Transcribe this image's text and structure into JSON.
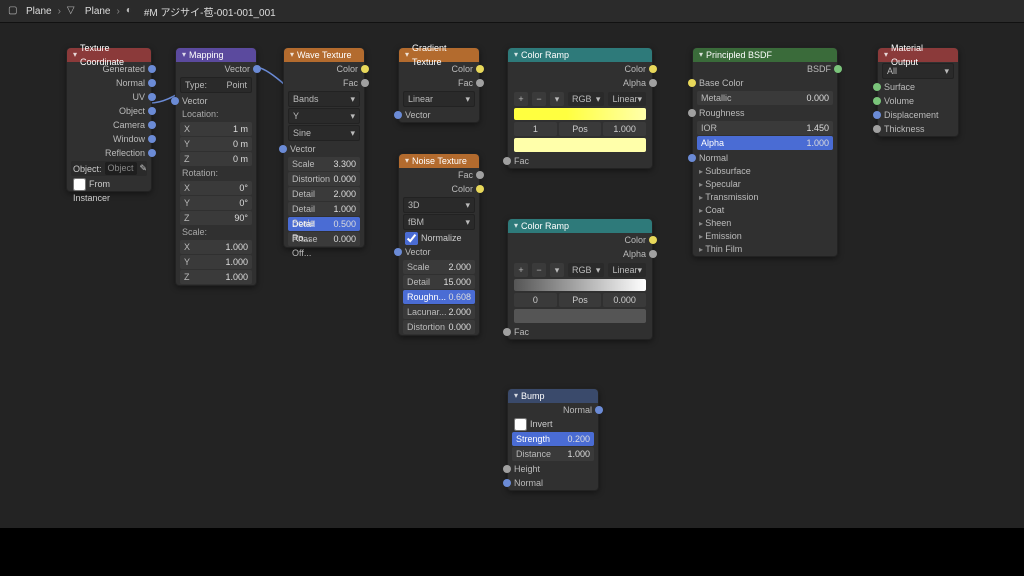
{
  "breadcrumb": {
    "a": "Plane",
    "b": "Plane",
    "c": "#M アジサイ-苞-001-001_001"
  },
  "texcoord": {
    "title": "Texture Coordinate",
    "outs": [
      "Generated",
      "Normal",
      "UV",
      "Object",
      "Camera",
      "Window",
      "Reflection"
    ],
    "objlbl": "Object:",
    "objval": "Object",
    "instancer": "From Instancer"
  },
  "mapping": {
    "title": "Mapping",
    "out": "Vector",
    "typelbl": "Type:",
    "typeval": "Point",
    "vec": "Vector",
    "loc": "Location:",
    "x": "X",
    "y": "Y",
    "z": "Z",
    "lx": "1 m",
    "ly": "0 m",
    "lz": "0 m",
    "rot": "Rotation:",
    "rx": "0°",
    "ry": "0°",
    "rz": "90°",
    "sca": "Scale:",
    "sx": "1.000",
    "sy": "1.000",
    "sz": "1.000"
  },
  "wave": {
    "title": "Wave Texture",
    "out_c": "Color",
    "out_f": "Fac",
    "bands": "Bands",
    "ydir": "Y",
    "sine": "Sine",
    "vec": "Vector",
    "scale": "Scale",
    "scalev": "3.300",
    "dist": "Distortion",
    "distv": "0.000",
    "det": "Detail",
    "detv": "2.000",
    "dsc": "Detail Scale",
    "dscv": "1.000",
    "dro": "Detail Ro...",
    "drov": "0.500",
    "pho": "Phase Off...",
    "phov": "0.000"
  },
  "grad": {
    "title": "Gradient Texture",
    "out_c": "Color",
    "out_f": "Fac",
    "type": "Linear",
    "vec": "Vector"
  },
  "noise": {
    "title": "Noise Texture",
    "out_f": "Fac",
    "out_c": "Color",
    "dim": "3D",
    "fbm": "fBM",
    "norm": "Normalize",
    "vec": "Vector",
    "scale": "Scale",
    "scalev": "2.000",
    "det": "Detail",
    "detv": "15.000",
    "rough": "Roughn...",
    "roughv": "0.608",
    "lac": "Lacunar...",
    "lacv": "2.000",
    "dist": "Distortion",
    "distv": "0.000"
  },
  "ramp1": {
    "title": "Color Ramp",
    "out_c": "Color",
    "out_a": "Alpha",
    "rgb": "RGB",
    "lin": "Linear",
    "p1": "1",
    "poslbl": "Pos",
    "posv": "1.000",
    "fac": "Fac"
  },
  "ramp2": {
    "title": "Color Ramp",
    "out_c": "Color",
    "out_a": "Alpha",
    "rgb": "RGB",
    "lin": "Linear",
    "p1": "0",
    "poslbl": "Pos",
    "posv": "0.000",
    "fac": "Fac"
  },
  "bump": {
    "title": "Bump",
    "out": "Normal",
    "inv": "Invert",
    "str": "Strength",
    "strv": "0.200",
    "dis": "Distance",
    "disv": "1.000",
    "h": "Height",
    "n": "Normal"
  },
  "bsdf": {
    "title": "Principled BSDF",
    "out": "BSDF",
    "base": "Base Color",
    "met": "Metallic",
    "metv": "0.000",
    "rough": "Roughness",
    "ior": "IOR",
    "iorv": "1.450",
    "alpha": "Alpha",
    "alphav": "1.000",
    "normal": "Normal",
    "exp": [
      "Subsurface",
      "Specular",
      "Transmission",
      "Coat",
      "Sheen",
      "Emission",
      "Thin Film"
    ]
  },
  "out": {
    "title": "Material Output",
    "all": "All",
    "s": "Surface",
    "v": "Volume",
    "d": "Displacement",
    "t": "Thickness"
  }
}
